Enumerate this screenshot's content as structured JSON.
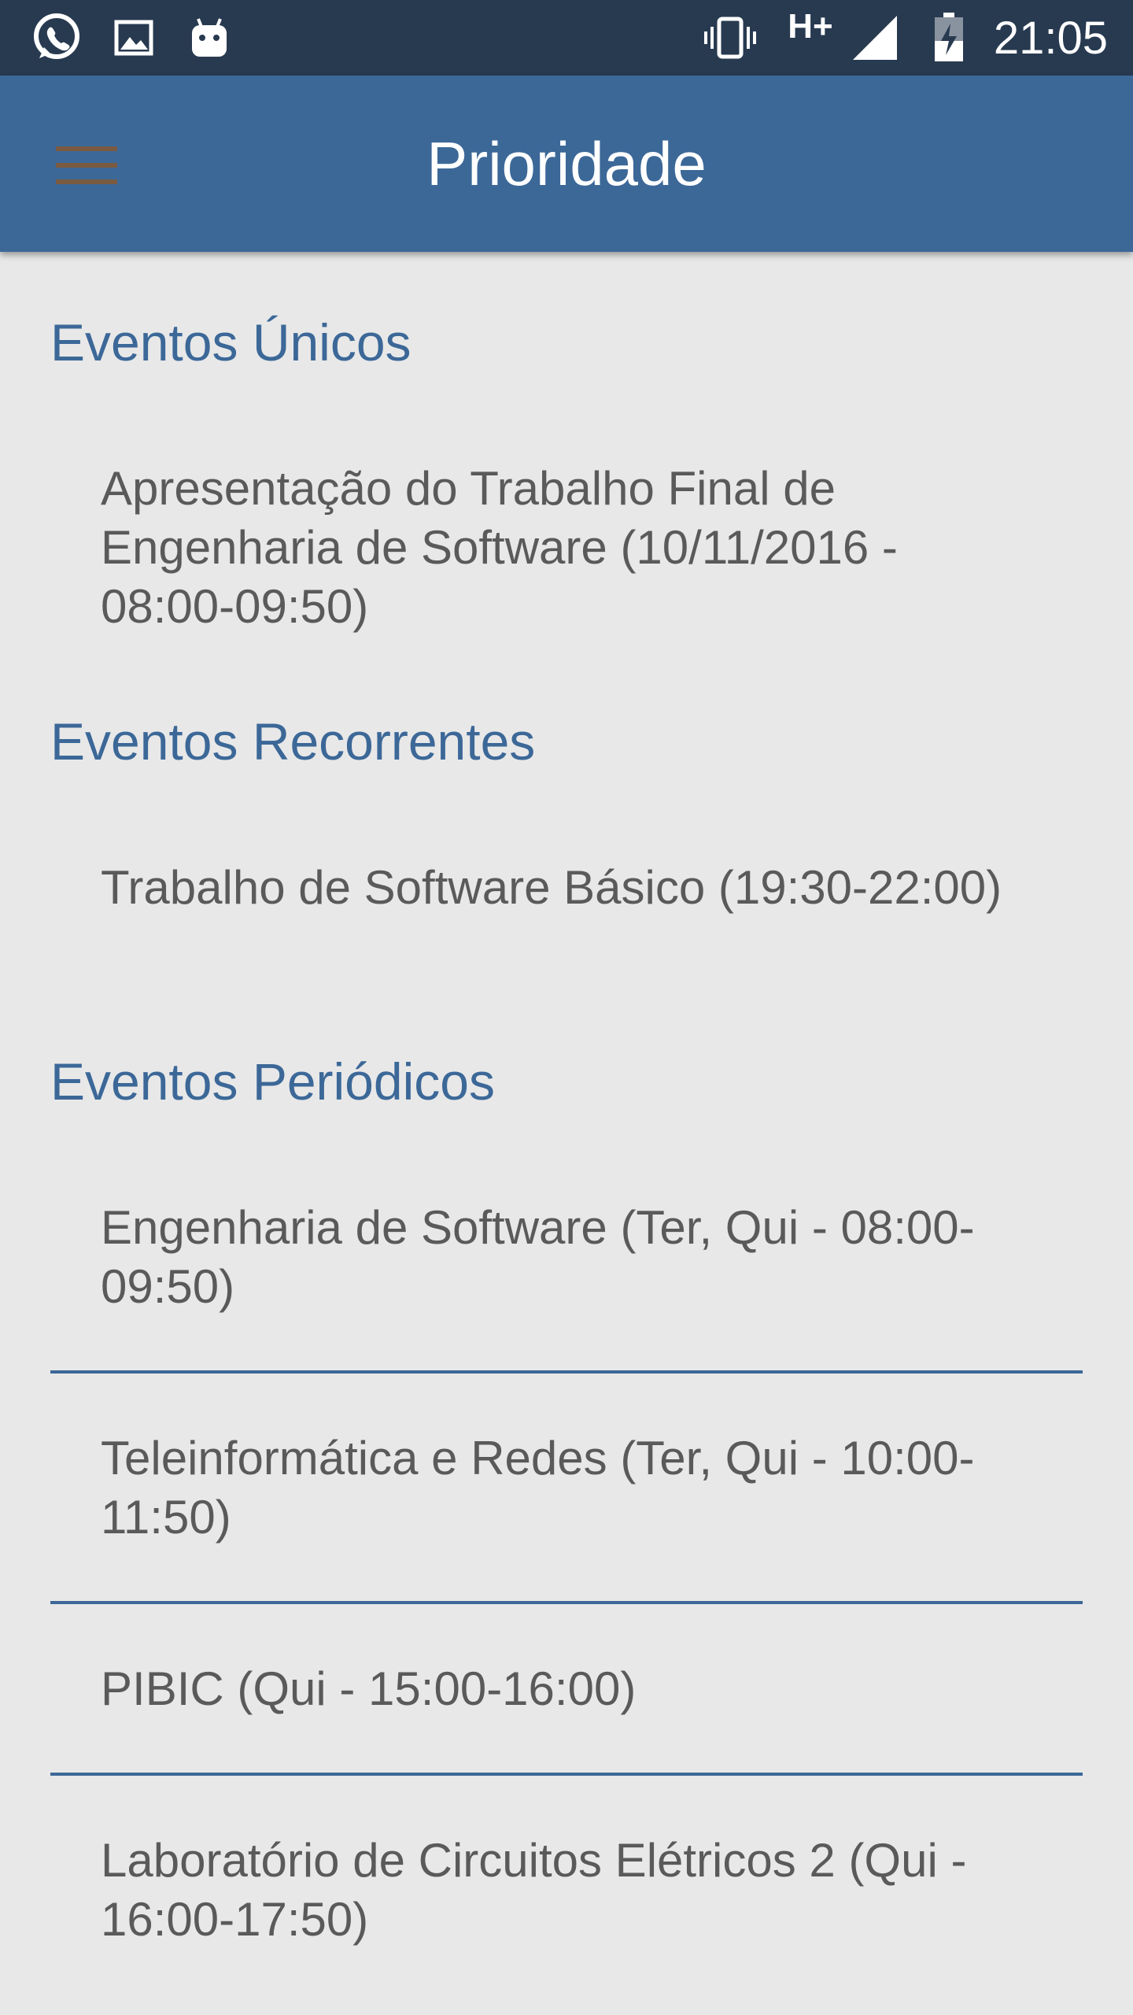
{
  "status_bar": {
    "time": "21:05",
    "network": "H+",
    "icons": [
      "whatsapp-icon",
      "image-icon",
      "android-icon",
      "vibrate-icon",
      "signal-icon",
      "battery-charging-icon"
    ]
  },
  "app_bar": {
    "title": "Prioridade",
    "menu_icon": "hamburger-menu-icon"
  },
  "sections": [
    {
      "title": "Eventos Únicos",
      "items": [
        "Apresentação do Trabalho Final de Engenharia de Software (10/11/2016 - 08:00-09:50)"
      ]
    },
    {
      "title": "Eventos Recorrentes",
      "items": [
        "Trabalho de Software Básico (19:30-22:00)"
      ]
    },
    {
      "title": "Eventos Periódicos",
      "items": [
        "Engenharia de Software (Ter, Qui - 08:00-09:50)",
        "Teleinformática e Redes (Ter, Qui - 10:00-11:50)",
        "PIBIC (Qui - 15:00-16:00)",
        "Laboratório de Circuitos Elétricos 2 (Qui - 16:00-17:50)"
      ]
    }
  ],
  "colors": {
    "status_bar": "#283a50",
    "app_bar": "#3c6898",
    "background": "#e8e8e8",
    "section_title": "#3c6898",
    "item_text": "#5a5a5a",
    "divider": "#3c6898"
  }
}
